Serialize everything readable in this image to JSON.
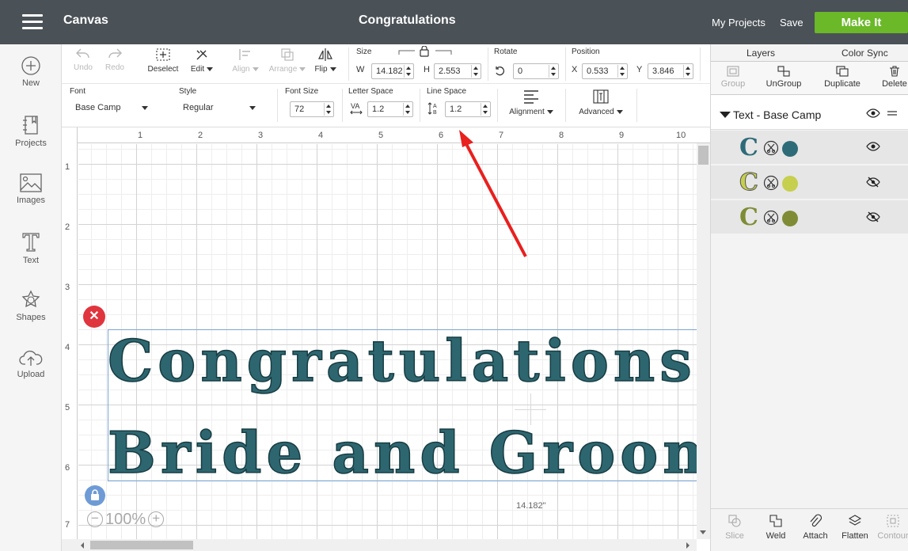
{
  "app": {
    "title": "Canvas",
    "document_title": "Congratulations"
  },
  "header": {
    "my_projects": "My Projects",
    "save": "Save",
    "make_it": "Make It"
  },
  "sidebar": {
    "items": [
      {
        "label": "New",
        "icon": "plus-circle-icon"
      },
      {
        "label": "Projects",
        "icon": "notebook-icon"
      },
      {
        "label": "Images",
        "icon": "image-icon"
      },
      {
        "label": "Text",
        "icon": "text-t-icon"
      },
      {
        "label": "Shapes",
        "icon": "shapes-icon"
      },
      {
        "label": "Upload",
        "icon": "cloud-upload-icon"
      }
    ]
  },
  "toolbar": {
    "undo": "Undo",
    "redo": "Redo",
    "deselect": "Deselect",
    "edit": "Edit",
    "align": "Align",
    "arrange": "Arrange",
    "flip": "Flip",
    "size_label": "Size",
    "w_label": "W",
    "w_value": "14.182",
    "h_label": "H",
    "h_value": "2.553",
    "rotate_label": "Rotate",
    "rotate_value": "0",
    "position_label": "Position",
    "x_label": "X",
    "x_value": "0.533",
    "y_label": "Y",
    "y_value": "3.846",
    "font_label": "Font",
    "font_value": "Base Camp",
    "style_label": "Style",
    "style_value": "Regular",
    "font_size_label": "Font Size",
    "font_size_value": "72",
    "letter_space_label": "Letter Space",
    "letter_space_value": "1.2",
    "line_space_label": "Line Space",
    "line_space_value": "1.2",
    "alignment": "Alignment",
    "advanced": "Advanced"
  },
  "canvas": {
    "ruler_top": [
      "1",
      "2",
      "3",
      "4",
      "5",
      "6",
      "7",
      "8",
      "9",
      "10"
    ],
    "ruler_left": [
      "1",
      "2",
      "3",
      "4",
      "5",
      "6",
      "7"
    ],
    "text_line1": "Congratulations",
    "text_line2": "Bride and Groom",
    "width_readout": "14.182\"",
    "zoom": "100%",
    "text_color": "#2e6670"
  },
  "right_panel": {
    "tabs": [
      "Layers",
      "Color Sync"
    ],
    "tools": [
      "Group",
      "UnGroup",
      "Duplicate",
      "Delete"
    ],
    "group_name": "Text - Base Camp",
    "layers": [
      {
        "letter": "C",
        "color": "#2e6b78",
        "visible": true
      },
      {
        "letter": "C",
        "color": "#c6cf4e",
        "visible": false
      },
      {
        "letter": "C",
        "color": "#7f8c35",
        "visible": false
      }
    ],
    "bottom_tools": [
      "Slice",
      "Weld",
      "Attach",
      "Flatten",
      "Contour"
    ]
  },
  "colors": {
    "topbar": "#4a5157",
    "make_it": "#6bb829",
    "arrow": "#e8201e"
  }
}
